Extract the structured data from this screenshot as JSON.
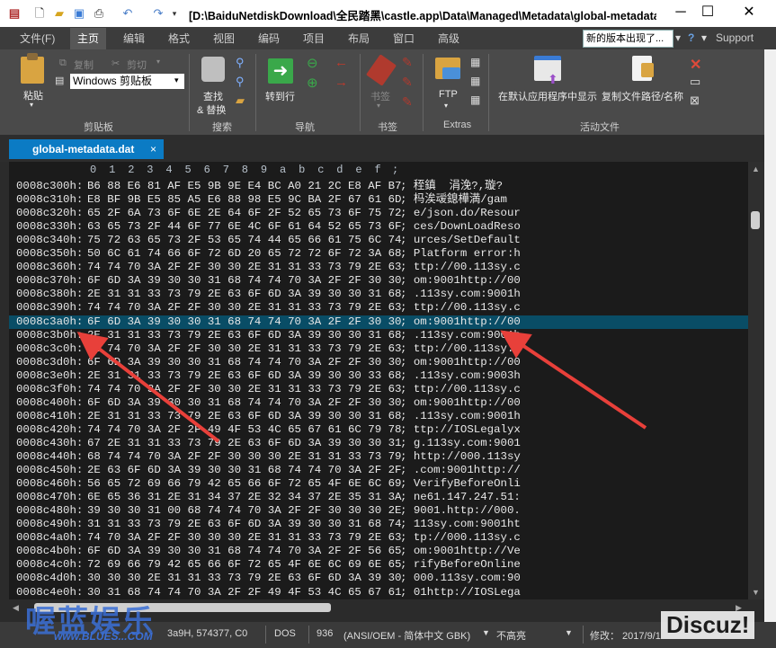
{
  "titlebar": {
    "title": "[D:\\BaiduNetdiskDownload\\全民踏黑\\castle.app\\Data\\Managed\\Metadata\\global-metadata...",
    "icons": [
      "file-icon",
      "new-icon",
      "open-folder-icon",
      "save-icon",
      "print-icon",
      "undo-icon",
      "redo-icon"
    ]
  },
  "menu": {
    "items": [
      "文件(F)",
      "主页",
      "编辑",
      "格式",
      "视图",
      "编码",
      "项目",
      "布局",
      "窗口",
      "高级"
    ],
    "active_index": 1,
    "notice": "新的版本出现了...",
    "support": "Support"
  },
  "ribbon": {
    "clipboard": {
      "paste": "粘贴",
      "copy": "复制",
      "cut": "剪切",
      "clipboard_select": "Windows 剪贴板",
      "group": "剪贴板"
    },
    "search": {
      "find_replace_1": "查找",
      "find_replace_2": "& 替换",
      "group": "搜索"
    },
    "navigation": {
      "goto": "转到行",
      "group": "导航"
    },
    "bookmarks": {
      "bookmark": "书签",
      "group": "书签"
    },
    "extras": {
      "ftp": "FTP",
      "group": "Extras"
    },
    "active_file": {
      "open_default": "在默认应用程序中显示",
      "copy_path": "复制文件路径/名称",
      "group": "活动文件"
    }
  },
  "tab": {
    "label": "global-metadata.dat",
    "close": "×"
  },
  "ruler": [
    "0",
    "1",
    "2",
    "3",
    "4",
    "5",
    "6",
    "7",
    "8",
    "9",
    "a",
    "b",
    "c",
    "d",
    "e",
    "f"
  ],
  "hex_rows": [
    {
      "addr": "0008c300h:",
      "hex": "B6 88 E6 81 AF E5 9B 9E E4 BC A0 21 2C E8 AF B7",
      "asc": "; 秷鎮  涓浼?,璇?"
    },
    {
      "addr": "0008c310h:",
      "hex": "E8 BF 9B E5 85 A5 E6 88 98 E5 9C BA 2F 67 61 6D",
      "asc": "; 杩涘叆鎴樺満/gam"
    },
    {
      "addr": "0008c320h:",
      "hex": "65 2F 6A 73 6F 6E 2E 64 6F 2F 52 65 73 6F 75 72",
      "asc": "; e/json.do/Resour"
    },
    {
      "addr": "0008c330h:",
      "hex": "63 65 73 2F 44 6F 77 6E 4C 6F 61 64 52 65 73 6F",
      "asc": "; ces/DownLoadReso"
    },
    {
      "addr": "0008c340h:",
      "hex": "75 72 63 65 73 2F 53 65 74 44 65 66 61 75 6C 74",
      "asc": "; urces/SetDefault"
    },
    {
      "addr": "0008c350h:",
      "hex": "50 6C 61 74 66 6F 72 6D 20 65 72 72 6F 72 3A 68",
      "asc": "; Platform error:h"
    },
    {
      "addr": "0008c360h:",
      "hex": "74 74 70 3A 2F 2F 30 30 2E 31 31 33 73 79 2E 63",
      "asc": "; ttp://00.113sy.c"
    },
    {
      "addr": "0008c370h:",
      "hex": "6F 6D 3A 39 30 30 31 68 74 74 70 3A 2F 2F 30 30",
      "asc": "; om:9001http://00"
    },
    {
      "addr": "0008c380h:",
      "hex": "2E 31 31 33 73 79 2E 63 6F 6D 3A 39 30 30 31 68",
      "asc": "; .113sy.com:9001h"
    },
    {
      "addr": "0008c390h:",
      "hex": "74 74 70 3A 2F 2F 30 30 2E 31 31 33 73 79 2E 63",
      "asc": "; ttp://00.113sy.c"
    },
    {
      "addr": "0008c3a0h:",
      "hex": "6F 6D 3A 39 30 30 31 68 74 74 70 3A 2F 2F 30 30",
      "asc": "; om:9001http://00"
    },
    {
      "addr": "0008c3b0h:",
      "hex": "2E 31 31 33 73 79 2E 63 6F 6D 3A 39 30 30 31 68",
      "asc": "; .113sy.com:9001h"
    },
    {
      "addr": "0008c3c0h:",
      "hex": "74 74 70 3A 2F 2F 30 30 2E 31 31 33 73 79 2E 63",
      "asc": "; ttp://00.113sy.c"
    },
    {
      "addr": "0008c3d0h:",
      "hex": "6F 6D 3A 39 30 30 31 68 74 74 70 3A 2F 2F 30 30",
      "asc": "; om:9001http://00"
    },
    {
      "addr": "0008c3e0h:",
      "hex": "2E 31 31 33 73 79 2E 63 6F 6D 3A 39 30 30 33 68",
      "asc": "; .113sy.com:9003h"
    },
    {
      "addr": "0008c3f0h:",
      "hex": "74 74 70 3A 2F 2F 30 30 2E 31 31 33 73 79 2E 63",
      "asc": "; ttp://00.113sy.c"
    },
    {
      "addr": "0008c400h:",
      "hex": "6F 6D 3A 39 30 30 31 68 74 74 70 3A 2F 2F 30 30",
      "asc": "; om:9001http://00"
    },
    {
      "addr": "0008c410h:",
      "hex": "2E 31 31 33 73 79 2E 63 6F 6D 3A 39 30 30 31 68",
      "asc": "; .113sy.com:9001h"
    },
    {
      "addr": "0008c420h:",
      "hex": "74 74 70 3A 2F 2F 49 4F 53 4C 65 67 61 6C 79 78",
      "asc": "; ttp://IOSLegalyx"
    },
    {
      "addr": "0008c430h:",
      "hex": "67 2E 31 31 33 73 79 2E 63 6F 6D 3A 39 30 30 31",
      "asc": "; g.113sy.com:9001"
    },
    {
      "addr": "0008c440h:",
      "hex": "68 74 74 70 3A 2F 2F 30 30 30 2E 31 31 33 73 79",
      "asc": "; http://000.113sy"
    },
    {
      "addr": "0008c450h:",
      "hex": "2E 63 6F 6D 3A 39 30 30 31 68 74 74 70 3A 2F 2F",
      "asc": "; .com:9001http://"
    },
    {
      "addr": "0008c460h:",
      "hex": "56 65 72 69 66 79 42 65 66 6F 72 65 4F 6E 6C 69",
      "asc": "; VerifyBeforeOnli"
    },
    {
      "addr": "0008c470h:",
      "hex": "6E 65 36 31 2E 31 34 37 2E 32 34 37 2E 35 31 3A",
      "asc": "; ne61.147.247.51:"
    },
    {
      "addr": "0008c480h:",
      "hex": "39 30 30 31 00 68 74 74 70 3A 2F 2F 30 30 30 2E",
      "asc": "; 9001.http://000."
    },
    {
      "addr": "0008c490h:",
      "hex": "31 31 33 73 79 2E 63 6F 6D 3A 39 30 30 31 68 74",
      "asc": "; 113sy.com:9001ht"
    },
    {
      "addr": "0008c4a0h:",
      "hex": "74 70 3A 2F 2F 30 30 30 2E 31 31 33 73 79 2E 63",
      "asc": "; tp://000.113sy.c"
    },
    {
      "addr": "0008c4b0h:",
      "hex": "6F 6D 3A 39 30 30 31 68 74 74 70 3A 2F 2F 56 65",
      "asc": "; om:9001http://Ve"
    },
    {
      "addr": "0008c4c0h:",
      "hex": "72 69 66 79 42 65 66 6F 72 65 4F 6E 6C 69 6E 65",
      "asc": "; rifyBeforeOnline"
    },
    {
      "addr": "0008c4d0h:",
      "hex": "30 30 30 2E 31 31 33 73 79 2E 63 6F 6D 3A 39 30",
      "asc": "; 000.113sy.com:90"
    },
    {
      "addr": "0008c4e0h:",
      "hex": "30 31 68 74 74 70 3A 2F 2F 49 4F 53 4C 65 67 61",
      "asc": "; 01http://IOSLega"
    }
  ],
  "highlight_row_index": 10,
  "status": {
    "pos": "3a9H, 574377, C0",
    "dos": "DOS",
    "codepage": "936",
    "encoding": "(ANSI/OEM - 简体中文 GBK)",
    "highlight": "不高亮",
    "modified": "修改：  2017/9/1"
  },
  "watermark": {
    "main": "喔蓝娱乐",
    "sub": "www.BLUES...COM",
    "discuz": "Discuz!"
  },
  "colors": {
    "highlight": "#094d66",
    "tab": "#0b7bc4",
    "arrow": "#e8403a"
  }
}
